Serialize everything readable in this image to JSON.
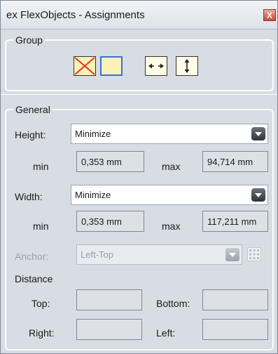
{
  "window": {
    "title": "ex FlexObjects - Assignments",
    "close_label": "X"
  },
  "group": {
    "legend": "Group",
    "buttons": [
      {
        "name": "no-size",
        "icon": "red-x-icon"
      },
      {
        "name": "selected-frame",
        "icon": "frame-icon"
      },
      {
        "name": "horizontal-size",
        "icon": "horizontal-arrows-icon"
      },
      {
        "name": "vertical-size",
        "icon": "vertical-arrows-icon"
      }
    ]
  },
  "general": {
    "legend": "General",
    "height": {
      "label": "Height:",
      "value": "Minimize",
      "min_label": "min",
      "min": "0,353 mm",
      "max_label": "max",
      "max": "94,714 mm"
    },
    "width": {
      "label": "Width:",
      "value": "Minimize",
      "min_label": "min",
      "min": "0,353 mm",
      "max_label": "max",
      "max": "117,211 mm"
    },
    "anchor": {
      "label": "Anchor:",
      "value": "Left-Top"
    },
    "distance": {
      "label": "Distance",
      "top": "Top:",
      "bottom": "Bottom:",
      "right": "Right:",
      "left": "Left:"
    }
  },
  "colors": {
    "panel": "#d8dde3",
    "button_fill": "#fbf2b7",
    "selected_border": "#3b6fd6",
    "red": "#e2362a"
  }
}
